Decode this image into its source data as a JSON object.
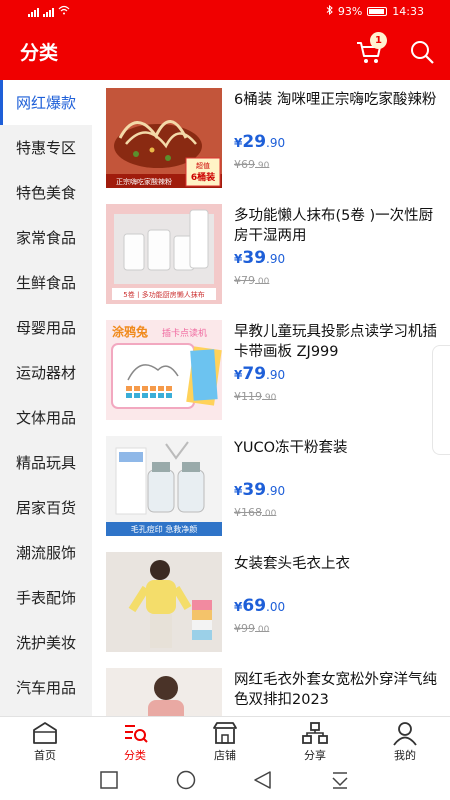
{
  "status_bar": {
    "battery": "93%",
    "time": "14:33"
  },
  "header": {
    "title": "分类",
    "cart_badge": "1"
  },
  "sidebar": {
    "items": [
      {
        "label": "网红爆款",
        "active": true
      },
      {
        "label": "特惠专区"
      },
      {
        "label": "特色美食"
      },
      {
        "label": "家常食品"
      },
      {
        "label": "生鲜食品"
      },
      {
        "label": "母婴用品"
      },
      {
        "label": "运动器材"
      },
      {
        "label": "文体用品"
      },
      {
        "label": "精品玩具"
      },
      {
        "label": "居家百货"
      },
      {
        "label": "潮流服饰"
      },
      {
        "label": "手表配饰"
      },
      {
        "label": "洗护美妆"
      },
      {
        "label": "汽车用品"
      }
    ]
  },
  "products": [
    {
      "name": "6桶装 淘咪哩正宗嗨吃家酸辣粉",
      "price_symbol": "¥",
      "price_int": "29",
      "price_dec": ".90",
      "orig_int": "¥69",
      "orig_dec": ".90",
      "image_text": [
        "超值",
        "6桶装",
        "正宗嗨吃家酸辣粉"
      ]
    },
    {
      "name": "多功能懒人抹布(5卷 )一次性厨房干湿两用",
      "price_symbol": "¥",
      "price_int": "39",
      "price_dec": ".90",
      "orig_int": "¥79",
      "orig_dec": ".00",
      "image_text": [
        "5卷丨多功能厨房懒人抹布"
      ]
    },
    {
      "name": "早教儿童玩具投影点读学习机插卡带画板 ZJ999",
      "price_symbol": "¥",
      "price_int": "79",
      "price_dec": ".90",
      "orig_int": "¥119",
      "orig_dec": ".90",
      "image_text": [
        "涂鸦兔",
        "插卡点读机"
      ]
    },
    {
      "name": "YUCO冻干粉套装",
      "price_symbol": "¥",
      "price_int": "39",
      "price_dec": ".90",
      "orig_int": "¥168",
      "orig_dec": ".00",
      "image_text": [
        "毛孔痘印 急救净颜"
      ]
    },
    {
      "name": "女装套头毛衣上衣",
      "price_symbol": "¥",
      "price_int": "69",
      "price_dec": ".00",
      "orig_int": "¥99",
      "orig_dec": ".00",
      "image_text": []
    },
    {
      "name": "网红毛衣外套女宽松外穿洋气纯色双排扣2023",
      "price_symbol": "",
      "price_int": "",
      "price_dec": "",
      "orig_int": "",
      "orig_dec": "",
      "image_text": []
    }
  ],
  "tabbar": {
    "items": [
      {
        "label": "首页",
        "icon": "home-icon"
      },
      {
        "label": "分类",
        "icon": "category-icon",
        "active": true
      },
      {
        "label": "店铺",
        "icon": "store-icon"
      },
      {
        "label": "分享",
        "icon": "share-icon"
      },
      {
        "label": "我的",
        "icon": "user-icon"
      }
    ]
  },
  "colors": {
    "accent": "#f00000",
    "price": "#1e5fd8",
    "sidebar_bg": "#f2f2f2"
  }
}
